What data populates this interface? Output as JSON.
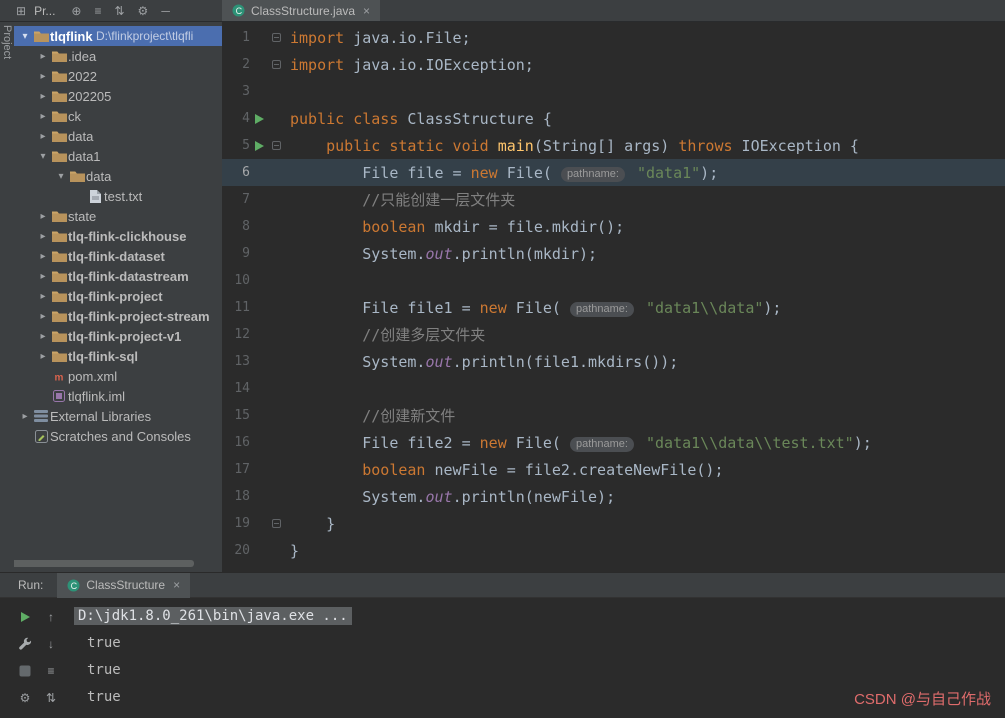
{
  "toolbar": {
    "project_selector_label": "Pr...",
    "left_icon": "window-icon",
    "right_icons": [
      "globe-icon",
      "sort-icon",
      "swap-icon",
      "gear-icon",
      "minimize-icon"
    ]
  },
  "tool_window_label": "Project",
  "project_tree": {
    "items": [
      {
        "depth": 0,
        "chevron": "down",
        "icon": "folder-icon",
        "label": "tlqflink",
        "path": "D:\\flinkproject\\tlqfli",
        "bold": true,
        "selected": true
      },
      {
        "depth": 1,
        "chevron": "right",
        "icon": "folder-icon",
        "label": ".idea"
      },
      {
        "depth": 1,
        "chevron": "right",
        "icon": "folder-icon",
        "label": "2022"
      },
      {
        "depth": 1,
        "chevron": "right",
        "icon": "folder-icon",
        "label": "202205"
      },
      {
        "depth": 1,
        "chevron": "right",
        "icon": "folder-icon",
        "label": "ck"
      },
      {
        "depth": 1,
        "chevron": "right",
        "icon": "folder-icon",
        "label": "data"
      },
      {
        "depth": 1,
        "chevron": "down",
        "icon": "folder-icon",
        "label": "data1"
      },
      {
        "depth": 2,
        "chevron": "down",
        "icon": "folder-icon",
        "label": "data"
      },
      {
        "depth": 3,
        "chevron": "none",
        "icon": "file-icon",
        "label": "test.txt"
      },
      {
        "depth": 1,
        "chevron": "right",
        "icon": "folder-icon",
        "label": "state"
      },
      {
        "depth": 1,
        "chevron": "right",
        "icon": "folder-icon",
        "label": "tlq-flink-clickhouse",
        "bold": true
      },
      {
        "depth": 1,
        "chevron": "right",
        "icon": "folder-icon",
        "label": "tlq-flink-dataset",
        "bold": true
      },
      {
        "depth": 1,
        "chevron": "right",
        "icon": "folder-icon",
        "label": "tlq-flink-datastream",
        "bold": true
      },
      {
        "depth": 1,
        "chevron": "right",
        "icon": "folder-icon",
        "label": "tlq-flink-project",
        "bold": true
      },
      {
        "depth": 1,
        "chevron": "right",
        "icon": "folder-icon",
        "label": "tlq-flink-project-stream",
        "bold": true
      },
      {
        "depth": 1,
        "chevron": "right",
        "icon": "folder-icon",
        "label": "tlq-flink-project-v1",
        "bold": true
      },
      {
        "depth": 1,
        "chevron": "right",
        "icon": "folder-icon",
        "label": "tlq-flink-sql",
        "bold": true
      },
      {
        "depth": 1,
        "chevron": "none",
        "icon": "maven-icon",
        "label": "pom.xml"
      },
      {
        "depth": 1,
        "chevron": "none",
        "icon": "iml-icon",
        "label": "tlqflink.iml"
      },
      {
        "depth": 0,
        "chevron": "right",
        "icon": "library-icon",
        "label": "External Libraries"
      },
      {
        "depth": 0,
        "chevron": "none",
        "icon": "scratches-icon",
        "label": "Scratches and Consoles"
      }
    ]
  },
  "editor": {
    "tab": {
      "icon": "class-icon",
      "label": "ClassStructure.java",
      "close": "×"
    },
    "lines": [
      {
        "num": "1",
        "fold": true,
        "tokens": [
          [
            "k",
            "import"
          ],
          [
            "p",
            " java.io.File;"
          ]
        ]
      },
      {
        "num": "2",
        "fold": true,
        "tokens": [
          [
            "k",
            "import"
          ],
          [
            "p",
            " java.io.IOException;"
          ]
        ]
      },
      {
        "num": "3",
        "tokens": []
      },
      {
        "num": "4",
        "run": true,
        "tokens": [
          [
            "k",
            "public class "
          ],
          [
            "p",
            "ClassStructure {"
          ]
        ]
      },
      {
        "num": "5",
        "run": true,
        "fold": true,
        "tokens": [
          [
            "p",
            "    "
          ],
          [
            "k",
            "public static void "
          ],
          [
            "m",
            "main"
          ],
          [
            "p",
            "(String[] args) "
          ],
          [
            "k",
            "throws"
          ],
          [
            "p",
            " IOException {"
          ]
        ]
      },
      {
        "num": "6",
        "current": true,
        "tokens": [
          [
            "p",
            "        File file = "
          ],
          [
            "k",
            "new"
          ],
          [
            "p",
            " File( "
          ],
          [
            "h",
            "pathname:"
          ],
          [
            "p",
            " "
          ],
          [
            "s",
            "\"data1\""
          ],
          [
            "p",
            ");"
          ]
        ]
      },
      {
        "num": "7",
        "tokens": [
          [
            "c",
            "        //只能创建一层文件夹"
          ]
        ]
      },
      {
        "num": "8",
        "tokens": [
          [
            "p",
            "        "
          ],
          [
            "k",
            "boolean"
          ],
          [
            "p",
            " mkdir = file.mkdir();"
          ]
        ]
      },
      {
        "num": "9",
        "tokens": [
          [
            "p",
            "        System."
          ],
          [
            "f",
            "out"
          ],
          [
            "p",
            ".println(mkdir);"
          ]
        ]
      },
      {
        "num": "10",
        "tokens": []
      },
      {
        "num": "11",
        "tokens": [
          [
            "p",
            "        File file1 = "
          ],
          [
            "k",
            "new"
          ],
          [
            "p",
            " File( "
          ],
          [
            "h",
            "pathname:"
          ],
          [
            "p",
            " "
          ],
          [
            "s",
            "\"data1\\\\data\""
          ],
          [
            "p",
            ");"
          ]
        ]
      },
      {
        "num": "12",
        "tokens": [
          [
            "c",
            "        //创建多层文件夹"
          ]
        ]
      },
      {
        "num": "13",
        "tokens": [
          [
            "p",
            "        System."
          ],
          [
            "f",
            "out"
          ],
          [
            "p",
            ".println(file1.mkdirs());"
          ]
        ]
      },
      {
        "num": "14",
        "tokens": []
      },
      {
        "num": "15",
        "tokens": [
          [
            "c",
            "        //创建新文件"
          ]
        ]
      },
      {
        "num": "16",
        "tokens": [
          [
            "p",
            "        File file2 = "
          ],
          [
            "k",
            "new"
          ],
          [
            "p",
            " File( "
          ],
          [
            "h",
            "pathname:"
          ],
          [
            "p",
            " "
          ],
          [
            "s",
            "\"data1\\\\data\\\\test.txt\""
          ],
          [
            "p",
            ");"
          ]
        ]
      },
      {
        "num": "17",
        "tokens": [
          [
            "p",
            "        "
          ],
          [
            "k",
            "boolean"
          ],
          [
            "p",
            " newFile = file2.createNewFile();"
          ]
        ]
      },
      {
        "num": "18",
        "tokens": [
          [
            "p",
            "        System."
          ],
          [
            "f",
            "out"
          ],
          [
            "p",
            ".println(newFile);"
          ]
        ]
      },
      {
        "num": "19",
        "fold": true,
        "tokens": [
          [
            "p",
            "    }"
          ]
        ]
      },
      {
        "num": "20",
        "tokens": [
          [
            "p",
            "}"
          ]
        ]
      }
    ]
  },
  "run_panel": {
    "label": "Run:",
    "tab": {
      "icon": "class-icon",
      "label": "ClassStructure",
      "close": "×"
    },
    "toolbar_icons": [
      "rerun-icon",
      "up-arrow-icon",
      "wrench-icon",
      "down-arrow-icon",
      "stop-icon",
      "soft-wrap-icon",
      "gears-icon",
      "scroll-end-icon"
    ],
    "console": [
      {
        "text": "D:\\jdk1.8.0_261\\bin\\java.exe ...",
        "selected": true
      },
      {
        "text": "true",
        "indent": true
      },
      {
        "text": "true",
        "indent": true
      },
      {
        "text": "true",
        "indent": true
      }
    ]
  },
  "watermark": "CSDN @与自己作战",
  "colors": {
    "selection_blue": "#4b6eaf",
    "keyword_orange": "#cc7832",
    "string_green": "#6a8759",
    "comment_gray": "#808080",
    "current_line": "#344049",
    "run_green": "#5fad65",
    "watermark_pink": "#e06c6c"
  }
}
